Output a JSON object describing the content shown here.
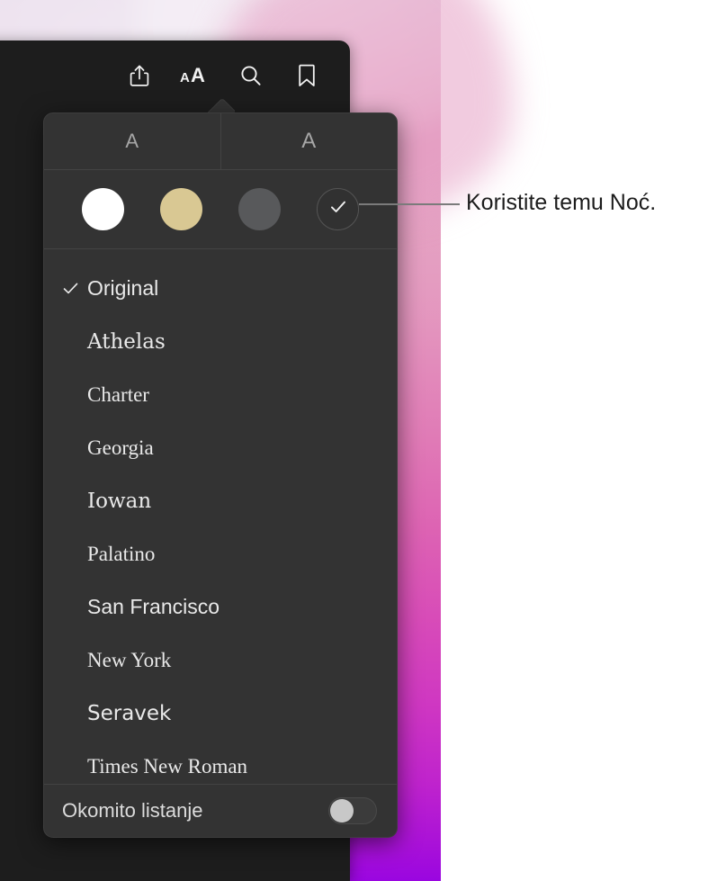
{
  "window": {
    "toolbar": {
      "buttons": [
        {
          "name": "share-icon",
          "label": "Share"
        },
        {
          "name": "font-size-icon",
          "label": "aA"
        },
        {
          "name": "search-icon",
          "label": "Search"
        },
        {
          "name": "bookmark-icon",
          "label": "Bookmark"
        }
      ]
    }
  },
  "popover": {
    "font_size": {
      "smaller_label": "A",
      "larger_label": "A"
    },
    "themes": [
      {
        "id": "white",
        "label": "White",
        "color": "#ffffff",
        "selected": false
      },
      {
        "id": "sepia",
        "label": "Sepia",
        "color": "#d9c893",
        "selected": false
      },
      {
        "id": "gray",
        "label": "Gray",
        "color": "#58595b",
        "selected": false
      },
      {
        "id": "night",
        "label": "Night",
        "color": "#313131",
        "selected": true
      }
    ],
    "fonts": [
      {
        "label": "Original",
        "selected": true
      },
      {
        "label": "Athelas",
        "selected": false
      },
      {
        "label": "Charter",
        "selected": false
      },
      {
        "label": "Georgia",
        "selected": false
      },
      {
        "label": "Iowan",
        "selected": false
      },
      {
        "label": "Palatino",
        "selected": false
      },
      {
        "label": "San Francisco",
        "selected": false
      },
      {
        "label": "New York",
        "selected": false
      },
      {
        "label": "Seravek",
        "selected": false
      },
      {
        "label": "Times New Roman",
        "selected": false
      }
    ],
    "check_glyph": "✓",
    "scroll": {
      "label": "Okomito listanje",
      "enabled": false
    }
  },
  "callout": {
    "text": "Koristite temu Noć."
  }
}
